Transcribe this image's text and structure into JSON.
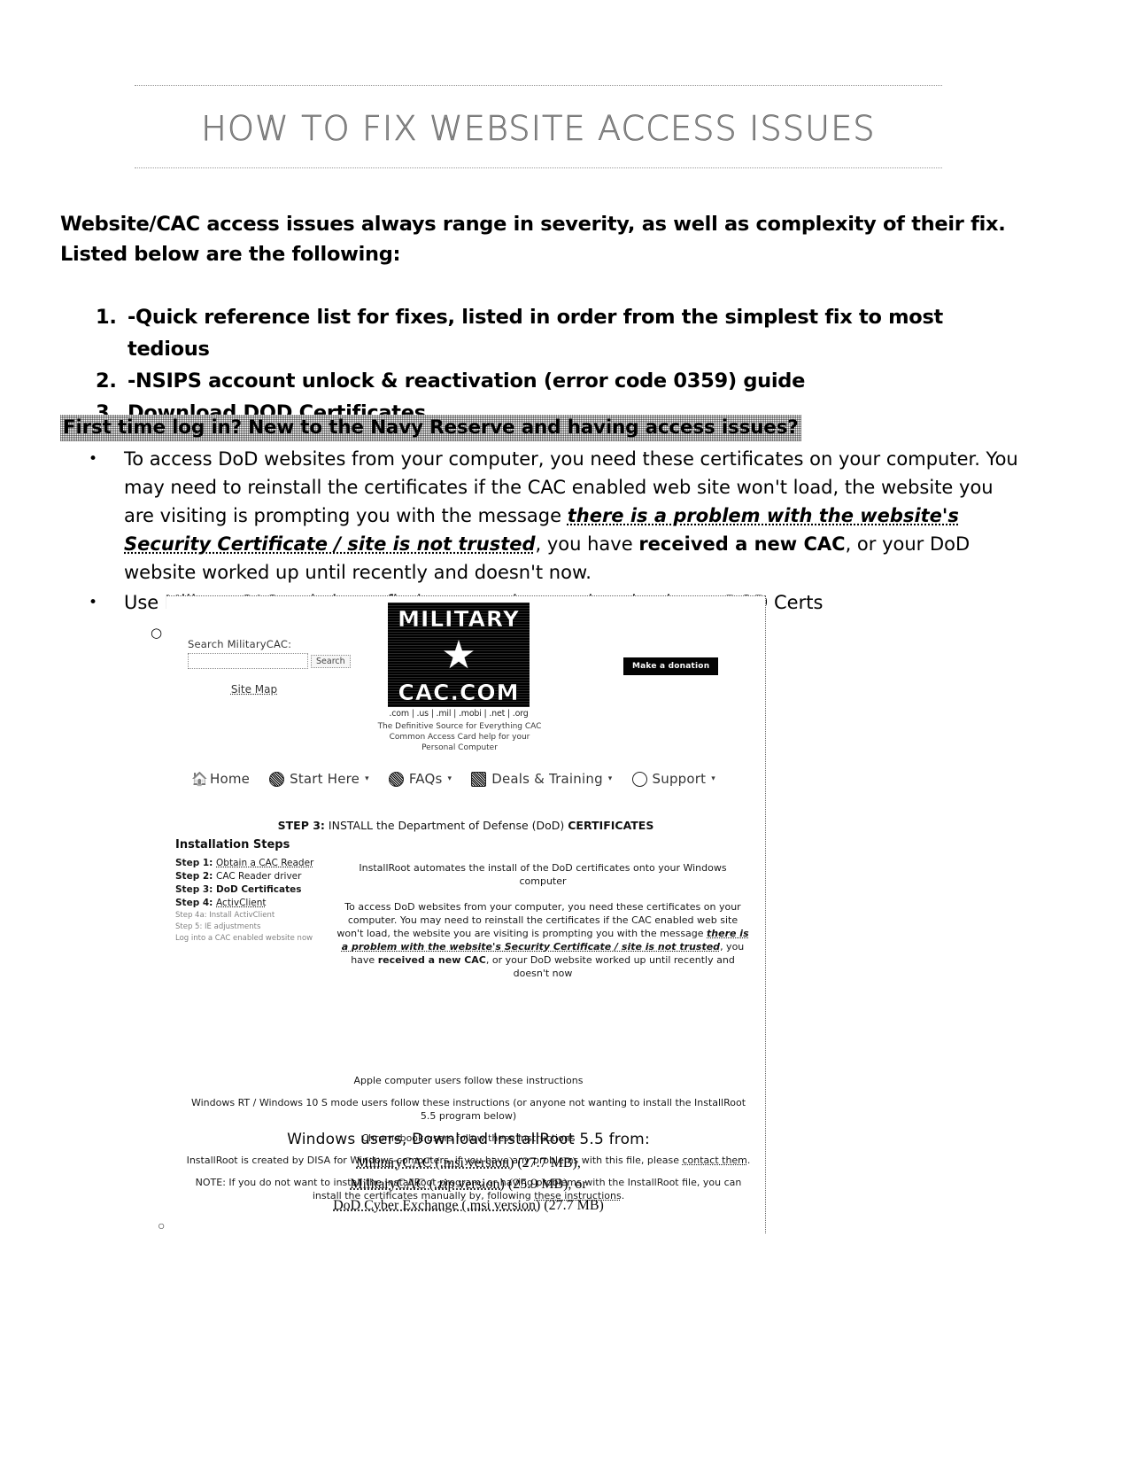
{
  "document": {
    "title": "HOW TO FIX WEBSITE ACCESS ISSUES",
    "intro": "Website/CAC access issues always range in severity, as well as complexity of their fix. Listed below are the following:",
    "numbered_list": [
      {
        "num": "1.",
        "text": "-Quick reference list for fixes, listed in order from the simplest fix to most tedious"
      },
      {
        "num": "2.",
        "text": "-NSIPS account unlock & reactivation (error code 0359) guide"
      },
      {
        "num": "3.",
        "text": "Download DOD Certificates"
      }
    ],
    "highlighted_heading": "First time log in? New to the Navy Reserve and having access issues?",
    "bullets": {
      "bullet_mark": "•",
      "sub_mark": "○",
      "item1_part1": "To access DoD websites from your computer, you need these certificates on your computer. You may need to reinstall the certificates if the CAC enabled web site won't load, the website you are visiting is prompting you with the message ",
      "item1_italic": "there is a problem with the website's Security Certificate / site is not trusted",
      "item1_part2": ", you have ",
      "item1_bold": "received a new CAC",
      "item1_part3": ", or your DoD website worked up until recently and doesn't now.",
      "item2": "Use Military CAC website to find steps on how to download your DOD Certs",
      "item2_url": "https://militarycac.com/dodcerts.htm"
    }
  },
  "screenshot": {
    "search_label": "Search MilitaryCAC:",
    "search_value": "",
    "search_placeholder": "",
    "search_button": "Search",
    "site_map_link": "Site Map",
    "donate_button": "Make a donation",
    "logo": {
      "line1": "MILITARY",
      "star": "★",
      "line2": "CAC.COM"
    },
    "tlds": ".com | .us | .mil | .mobi | .net | .org",
    "tagline_line1": "The Definitive Source for Everything CAC",
    "tagline_line2": "Common Access Card help for your",
    "tagline_line3": "Personal Computer",
    "nav": [
      {
        "label": "Home",
        "icon": "home-icon",
        "caret": ""
      },
      {
        "label": "Start Here",
        "icon": "circle-icon",
        "caret": "▾"
      },
      {
        "label": "FAQs",
        "icon": "circle-icon",
        "caret": "▾"
      },
      {
        "label": "Deals & Training",
        "icon": "grid-icon",
        "caret": "▾"
      },
      {
        "label": "Support",
        "icon": "arrow-circle-icon",
        "caret": "▾"
      }
    ],
    "step3_prefix": "STEP 3:",
    "step3_mid": "INSTALL the Department of Defense (DoD) ",
    "step3_suffix": "CERTIFICATES",
    "installation_steps_title": "Installation Steps",
    "installation_steps": [
      {
        "label": "Step 1: ",
        "link": "Obtain a CAC Reader",
        "faded": false
      },
      {
        "label": "Step 2: ",
        "link": "CAC Reader driver",
        "faded": false
      },
      {
        "label": "Step 3: ",
        "link": "DoD Certificates",
        "faded": false
      },
      {
        "label": "Step 4: ",
        "link": "ActivClient",
        "faded": false
      },
      {
        "label": "Step 4a: ",
        "link": "Install ActivClient",
        "faded": true
      },
      {
        "label": "Step 5: ",
        "link": "IE adjustments",
        "faded": true
      },
      {
        "label": "Log into a CAC enabled website now",
        "link": "",
        "faded": true
      }
    ],
    "main_para1": "InstallRoot automates the install of the DoD certificates onto your Windows computer",
    "main_para2_a": "To access DoD websites from your computer, you need these certificates on your computer.  You may need to reinstall the certificates if the CAC enabled web site won't load, the website you are visiting is prompting you with the message ",
    "main_para2_b": "there is a problem with the website's Security Certificate / site is not trusted",
    "main_para2_c": ", you have ",
    "main_para2_d": "received a new CAC",
    "main_para2_e": ", or your DoD website worked up until recently and doesn't now",
    "link_apple": "Apple computer users follow these instructions",
    "link_winrt_pre": "",
    "link_winrt": "Windows RT / Windows 10 S mode users follow these instructions",
    "link_winrt_post": " (or anyone not wanting to install the InstallRoot 5.5 program below)",
    "link_chromebook": "Chromebook users follow these instructions",
    "note_disa_a": "InstallRoot is created by DISA for Windows computers, if you have any problems with this file, please ",
    "note_disa_link": "contact them",
    "note_disa_b": ".",
    "note_manual_a": "NOTE: If you do not want to install the InstallRoot program, or having problems with the InstallRoot file, you can install the certificates manually by, following ",
    "note_manual_link": "these instructions",
    "note_manual_b": ".",
    "download_heading": "Windows users, Download InstallRoot 5.5 from:",
    "downloads": [
      {
        "link": "MilitaryCAC (.msi version)",
        "size": " (27.7 MB),",
        "trailing": ""
      },
      {
        "link": "MilitaryCAC (.zip version)",
        "size": " (25.9 MB), or",
        "trailing": ""
      },
      {
        "link": "DoD Cyber Exchange (.msi version)",
        "size": " (27.7 MB)",
        "trailing": ""
      }
    ]
  }
}
